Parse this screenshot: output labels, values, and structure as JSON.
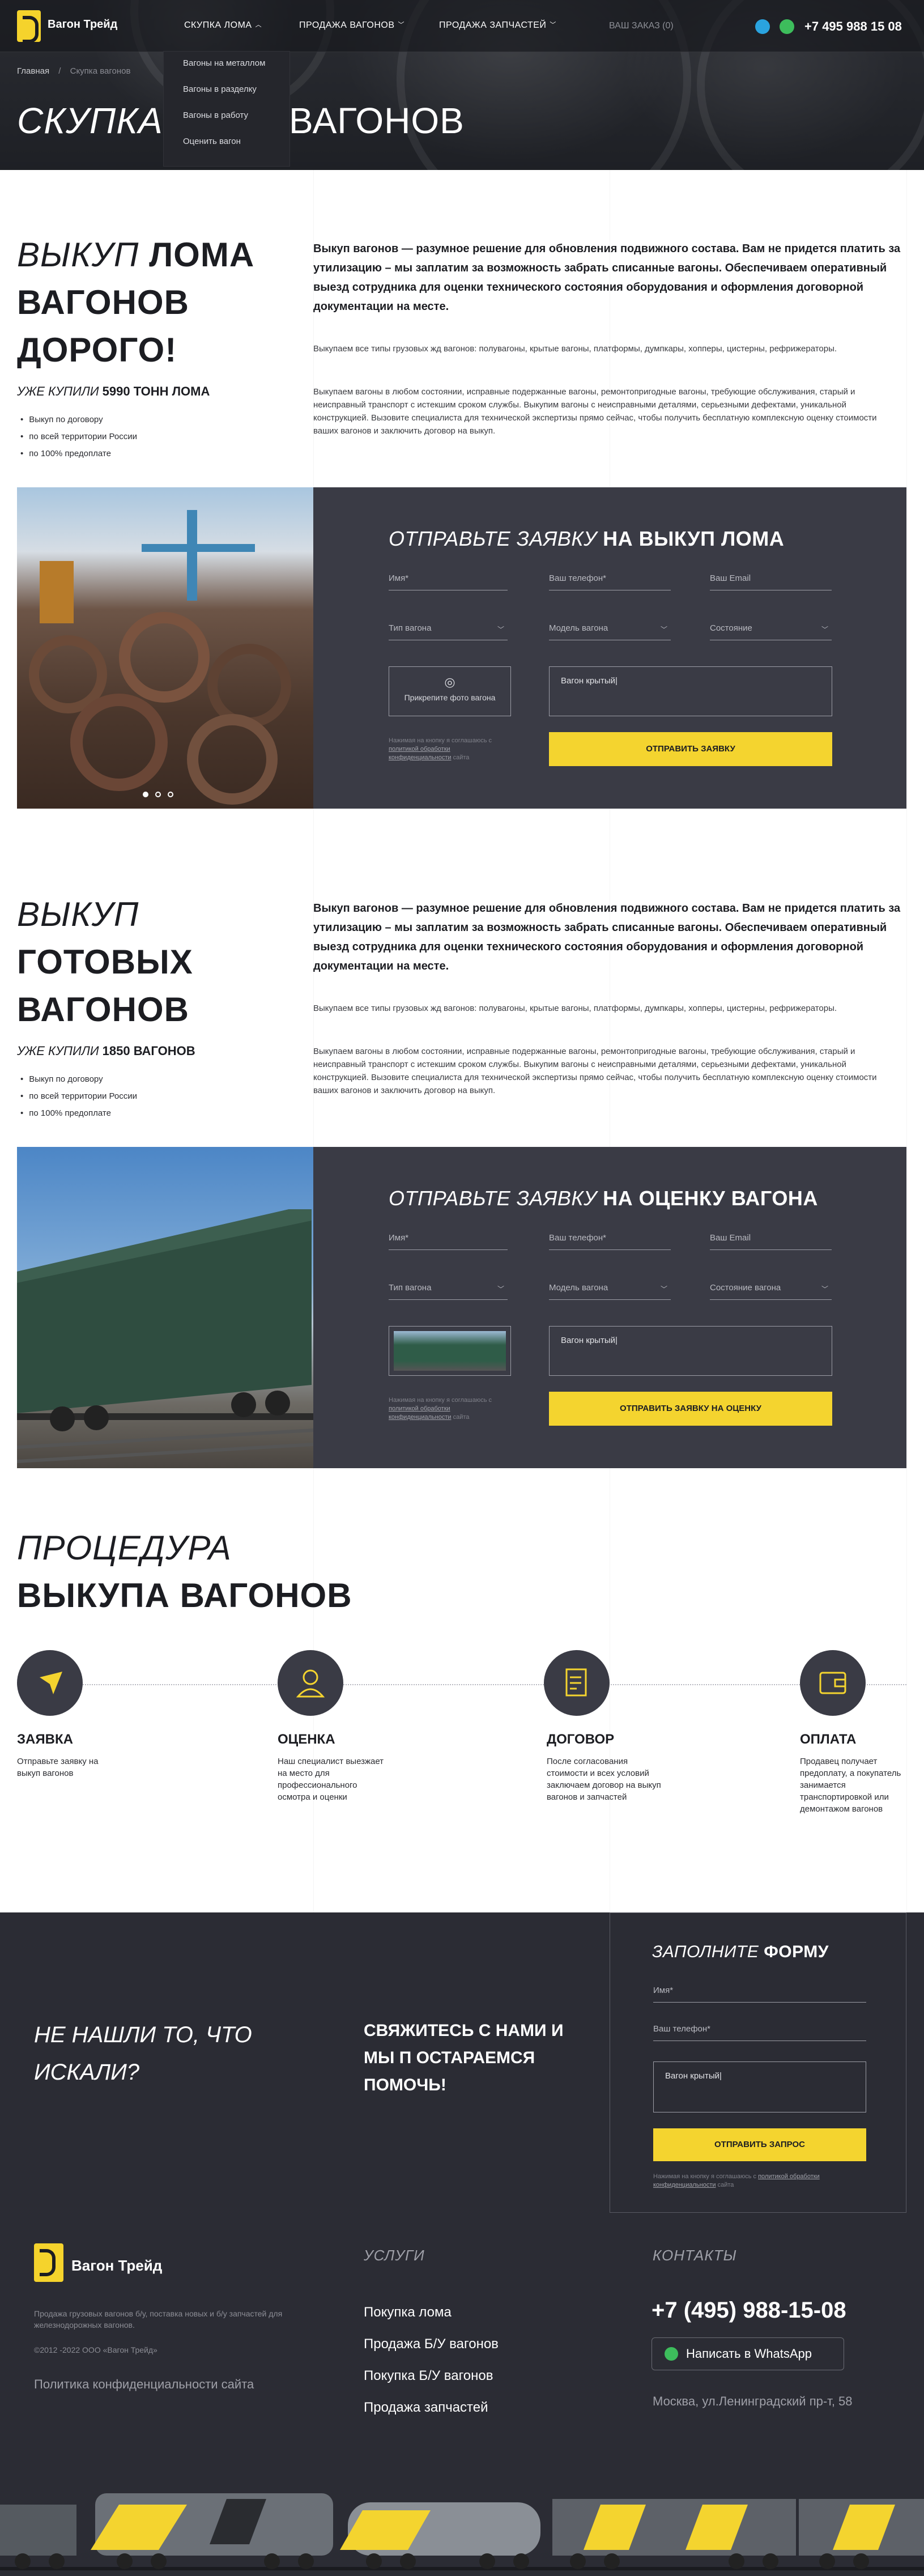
{
  "header": {
    "logo_text": "Вагон Трейд",
    "nav": [
      {
        "label": "СКУПКА ЛОМА"
      },
      {
        "label": "ПРОДАЖА ВАГОНОВ"
      },
      {
        "label": "ПРОДАЖА ЗАПЧАСТЕЙ"
      }
    ],
    "order_label": "ВАШ ЗАКАЗ (0)",
    "phone": "+7 495 988 15 08",
    "dropdown": [
      "Вагоны на металлом",
      "Вагоны в разделку",
      "Вагоны в работу",
      "Оценить вагон"
    ]
  },
  "breadcrumb": {
    "home": "Главная",
    "sep": "/",
    "current": "Скупка вагонов"
  },
  "hero": {
    "title_left": "СКУПКА",
    "title_right": "ВАГОНОВ"
  },
  "section1": {
    "h_line1_it": "ВЫКУП",
    "h_line1_b": "ЛОМА",
    "h_line2": "ВАГОНОВ",
    "h_line3": "ДОРОГО!",
    "sub_it": "УЖЕ КУПИЛИ",
    "sub_b": "5990 ТОНН ЛОМА",
    "bullets": [
      "Выкуп по договору",
      "по всей территории России",
      "по 100% предоплате"
    ],
    "lead": "Выкуп вагонов — разумное решение для обновления подвижного состава. Вам не придется платить за утилизацию – мы заплатим за возможность забрать списанные вагоны. Обеспечиваем оперативный выезд сотрудника для оценки технического состояния оборудования и оформления договорной документации на месте.",
    "p1": "Выкупаем все типы грузовых жд вагонов: полувагоны, крытые вагоны, платформы, думпкары, хопперы, цистерны, рефрижераторы.",
    "p2": "Выкупаем вагоны в любом состоянии, исправные подержанные вагоны, ремонтопригодные вагоны, требующие обслуживания, старый и неисправный транспорт с истекшим сроком службы. Выкупим вагоны с неисправными деталями, серьезными дефектами, уникальной конструкцией. Вызовите специалиста для технической экспертизы прямо сейчас, чтобы получить бесплатную комплексную оценку стоимости ваших вагонов и заключить договор на выкуп."
  },
  "form1": {
    "title_it": "ОТПРАВЬТЕ ЗАЯВКУ",
    "title_b": "НА ВЫКУП ЛОМА",
    "name": "Имя*",
    "phone": "Ваш телефон*",
    "email": "Ваш Email",
    "sel1": "Тип вагона",
    "sel2": "Модель вагона",
    "sel3": "Состояние",
    "upload": "Прикрепите фото вагона",
    "comment": "Вагон крытый|",
    "button": "ОТПРАВИТЬ ЗАЯВКУ",
    "consent": "Нажимая на кнопку я соглашаюсь с",
    "consent_link": "политикой обработки конфиденциальности",
    "consent_tail": "сайта"
  },
  "section2": {
    "h_line1_it": "ВЫКУП",
    "h_line2": "ГОТОВЫХ",
    "h_line3": "ВАГОНОВ",
    "sub_it": "УЖЕ КУПИЛИ",
    "sub_b": "1850 ВАГОНОВ",
    "bullets": [
      "Выкуп по договору",
      "по всей территории России",
      "по 100% предоплате"
    ],
    "lead": "Выкуп вагонов — разумное решение для обновления подвижного состава. Вам не придется платить за утилизацию – мы заплатим за возможность забрать списанные вагоны. Обеспечиваем оперативный выезд сотрудника для оценки технического состояния оборудования и оформления договорной документации на месте.",
    "p1": "Выкупаем все типы грузовых жд вагонов: полувагоны, крытые вагоны, платформы, думпкары, хопперы, цистерны, рефрижераторы.",
    "p2": "Выкупаем вагоны в любом состоянии, исправные подержанные вагоны, ремонтопригодные вагоны, требующие обслуживания, старый и неисправный транспорт с истекшим сроком службы. Выкупим вагоны с неисправными деталями, серьезными дефектами, уникальной конструкцией. Вызовите специалиста для технической экспертизы прямо сейчас, чтобы получить бесплатную комплексную оценку стоимости ваших вагонов и заключить договор на выкуп."
  },
  "form2": {
    "title_it": "ОТПРАВЬТЕ ЗАЯВКУ",
    "title_b": "НА ОЦЕНКУ ВАГОНА",
    "name": "Имя*",
    "phone": "Ваш телефон*",
    "email": "Ваш Email",
    "sel1": "Тип вагона",
    "sel2": "Модель вагона",
    "sel3": "Состояние вагона",
    "comment": "Вагон крытый|",
    "button": "ОТПРАВИТЬ ЗАЯВКУ НА ОЦЕНКУ",
    "consent": "Нажимая на кнопку я соглашаюсь с",
    "consent_link": "политикой обработки конфиденциальности",
    "consent_tail": "сайта"
  },
  "procedure": {
    "h_it": "ПРОЦЕДУРА",
    "h_b": "ВЫКУПА ВАГОНОВ",
    "steps": [
      {
        "title": "ЗАЯВКА",
        "text": "Отправьте заявку на выкуп вагонов",
        "icon": "send-icon"
      },
      {
        "title": "ОЦЕНКА",
        "text": "Наш специалист выезжает на место для профессионального осмотра и оценки",
        "icon": "specialist-icon"
      },
      {
        "title": "ДОГОВОР",
        "text": "После согласования стоимости и всех условий заключаем договор на выкуп вагонов и запчастей",
        "icon": "contract-icon"
      },
      {
        "title": "ОПЛАТА",
        "text": "Продавец получает предоплату, а покупатель занимается транспортировкой или демонтажом вагонов",
        "icon": "wallet-icon"
      }
    ]
  },
  "contact_band": {
    "left": "НЕ НАШЛИ ТО, ЧТО ИСКАЛИ?",
    "mid": "СВЯЖИТЕСЬ С НАМИ И МЫ П ОСТАРАЕМСЯ ПОМОЧЬ!",
    "form_title_it": "ЗАПОЛНИТЕ",
    "form_title_b": "ФОРМУ",
    "name": "Имя*",
    "phone": "Ваш телефон*",
    "comment": "Вагон крытый|",
    "button": "ОТПРАВИТЬ ЗАПРОС",
    "consent": "Нажимая на кнопку я соглашаюсь с",
    "consent_link": "политикой обработки конфиденциальности",
    "consent_tail": "сайта"
  },
  "footer": {
    "logo_text": "Вагон Трейд",
    "about": "Продажа грузовых вагонов б/у, поставка новых и б/у запчастей для железнодорожных вагонов.",
    "copyright": "©2012 -2022 ООО «Вагон Трейд»",
    "policy": "Политика конфиденциальности сайта",
    "services_title": "УСЛУГИ",
    "services": [
      "Покупка лома",
      "Продажа Б/У вагонов",
      "Покупка Б/У вагонов",
      "Продажа запчастей"
    ],
    "contacts_title": "КОНТАКТЫ",
    "phone": "+7 (495) 988-15-08",
    "whatsapp": "Написать в WhatsApp",
    "address": "Москва, ул.Ленинградский пр-т, 58"
  },
  "colors": {
    "accent": "#f4d42f",
    "dark": "#3a3b45",
    "band": "#2b2c34"
  }
}
